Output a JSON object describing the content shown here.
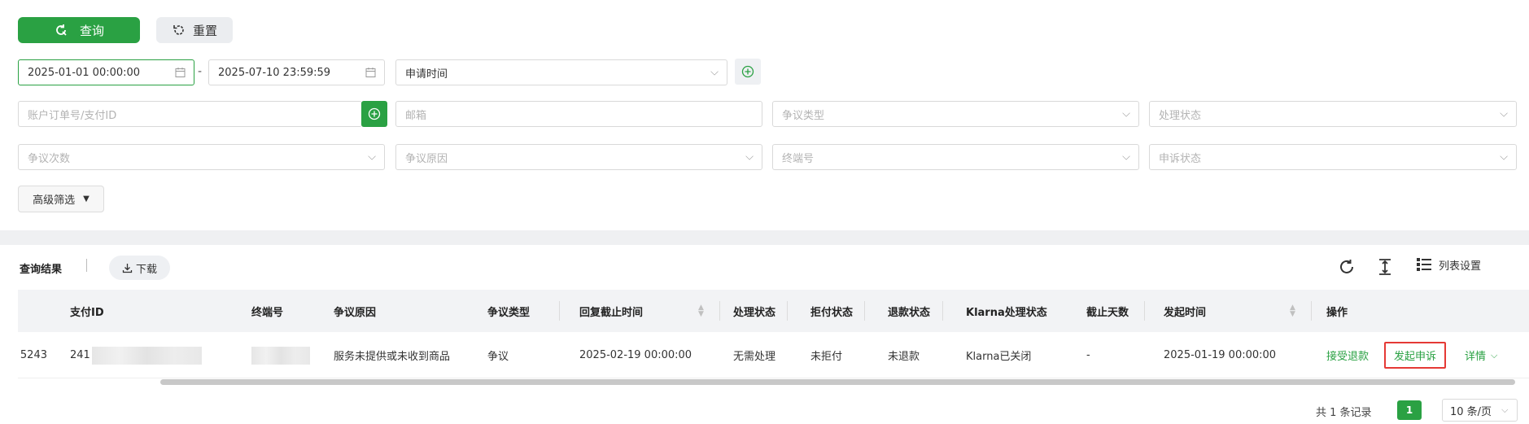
{
  "toolbar": {
    "query_label": "查询",
    "reset_label": "重置"
  },
  "filters": {
    "start_date": "2025-01-01 00:00:00",
    "end_date": "2025-07-10 23:59:59",
    "date_separator": "-",
    "time_type": "申请时间",
    "order_id_placeholder": "账户订单号/支付ID",
    "email_placeholder": "邮箱",
    "dispute_type_placeholder": "争议类型",
    "process_status_placeholder": "处理状态",
    "dispute_count_placeholder": "争议次数",
    "dispute_reason_placeholder": "争议原因",
    "terminal_placeholder": "终端号",
    "appeal_status_placeholder": "申诉状态",
    "advanced_label": "高级筛选"
  },
  "results": {
    "title": "查询结果",
    "download_label": "下载",
    "column_settings_label": "列表设置"
  },
  "table": {
    "headers": {
      "pay_id": "支付ID",
      "terminal": "终端号",
      "reason": "争议原因",
      "type": "争议类型",
      "reply_deadline": "回复截止时间",
      "process_status": "处理状态",
      "chargeback_status": "拒付状态",
      "refund_status": "退款状态",
      "klarna_status": "Klarna处理状态",
      "deadline_days": "截止天数",
      "created_time": "发起时间",
      "actions": "操作"
    },
    "rows": [
      {
        "order_tail": "5243",
        "pay_id_prefix": "241",
        "reason": "服务未提供或未收到商品",
        "type": "争议",
        "reply_deadline": "2025-02-19 00:00:00",
        "process_status": "无需处理",
        "chargeback_status": "未拒付",
        "refund_status": "未退款",
        "klarna_status": "Klarna已关闭",
        "deadline_days": "-",
        "created_time": "2025-01-19 00:00:00",
        "action_accept": "接受退款",
        "action_appeal": "发起申诉",
        "action_detail": "详情"
      }
    ]
  },
  "pagination": {
    "total": "共 1 条记录",
    "current_page": "1",
    "page_size": "10 条/页"
  },
  "colors": {
    "accent": "#2aa143",
    "highlight_border": "#e53935"
  }
}
